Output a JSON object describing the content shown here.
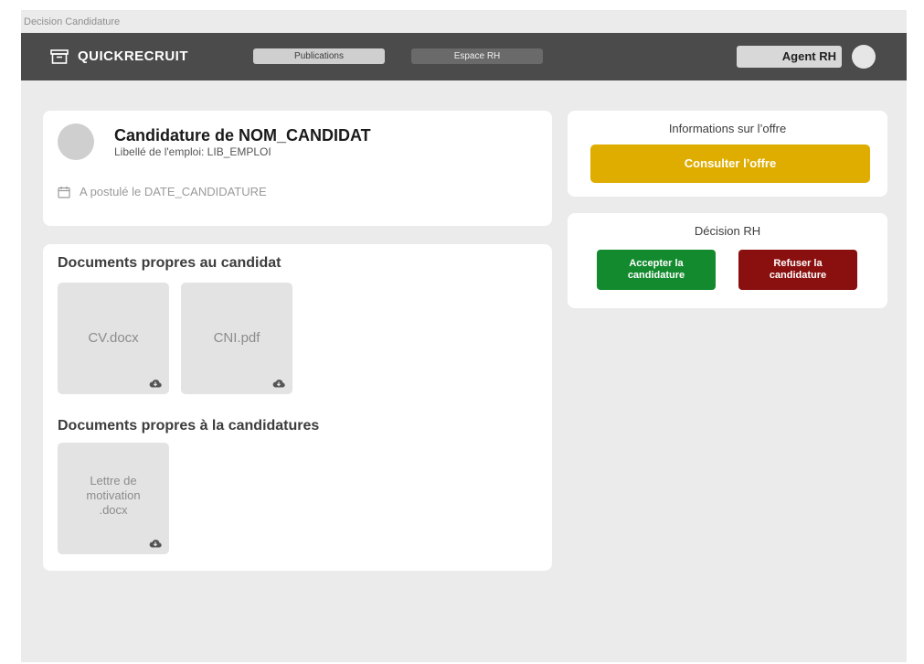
{
  "window": {
    "title": "Decision Candidature"
  },
  "navbar": {
    "brand": "QUICKRECRUIT",
    "brand_icon": "archive-box-icon",
    "nav_items": [
      {
        "label": "Publications",
        "active": true
      },
      {
        "label": "Espace RH",
        "active": false
      }
    ],
    "agent_label": "Agent RH",
    "background_color": "#4b4b4b"
  },
  "candidate": {
    "name": "Candidature de NOM_CANDIDAT",
    "job": "Libellé de l'emploi: LIB_EMPLOI",
    "date": "A postulé le DATE_CANDIDATURE",
    "date_icon": "calendar-icon"
  },
  "documents": {
    "candidate_title": "Documents propres au candidat",
    "candidate_files": [
      {
        "name": "CV.docx"
      },
      {
        "name": "CNI.pdf"
      }
    ],
    "application_title": "Documents propres à la candidatures",
    "application_files": [
      {
        "name": "Lettre de motivation .docx",
        "lines": [
          "Lettre de",
          "motivation",
          ".docx"
        ]
      }
    ],
    "download_icon": "cloud-download-icon"
  },
  "offer": {
    "title": "Informations sur l’offre",
    "button": "Consulter l’offre",
    "button_color": "#dfad00"
  },
  "decision": {
    "title": "Décision RH",
    "accept_lines": [
      "Accepter la",
      "candidature"
    ],
    "refuse_lines": [
      "Refuser la",
      "candidature"
    ],
    "accept_color": "#138a2e",
    "refuse_color": "#8a0f0f"
  }
}
